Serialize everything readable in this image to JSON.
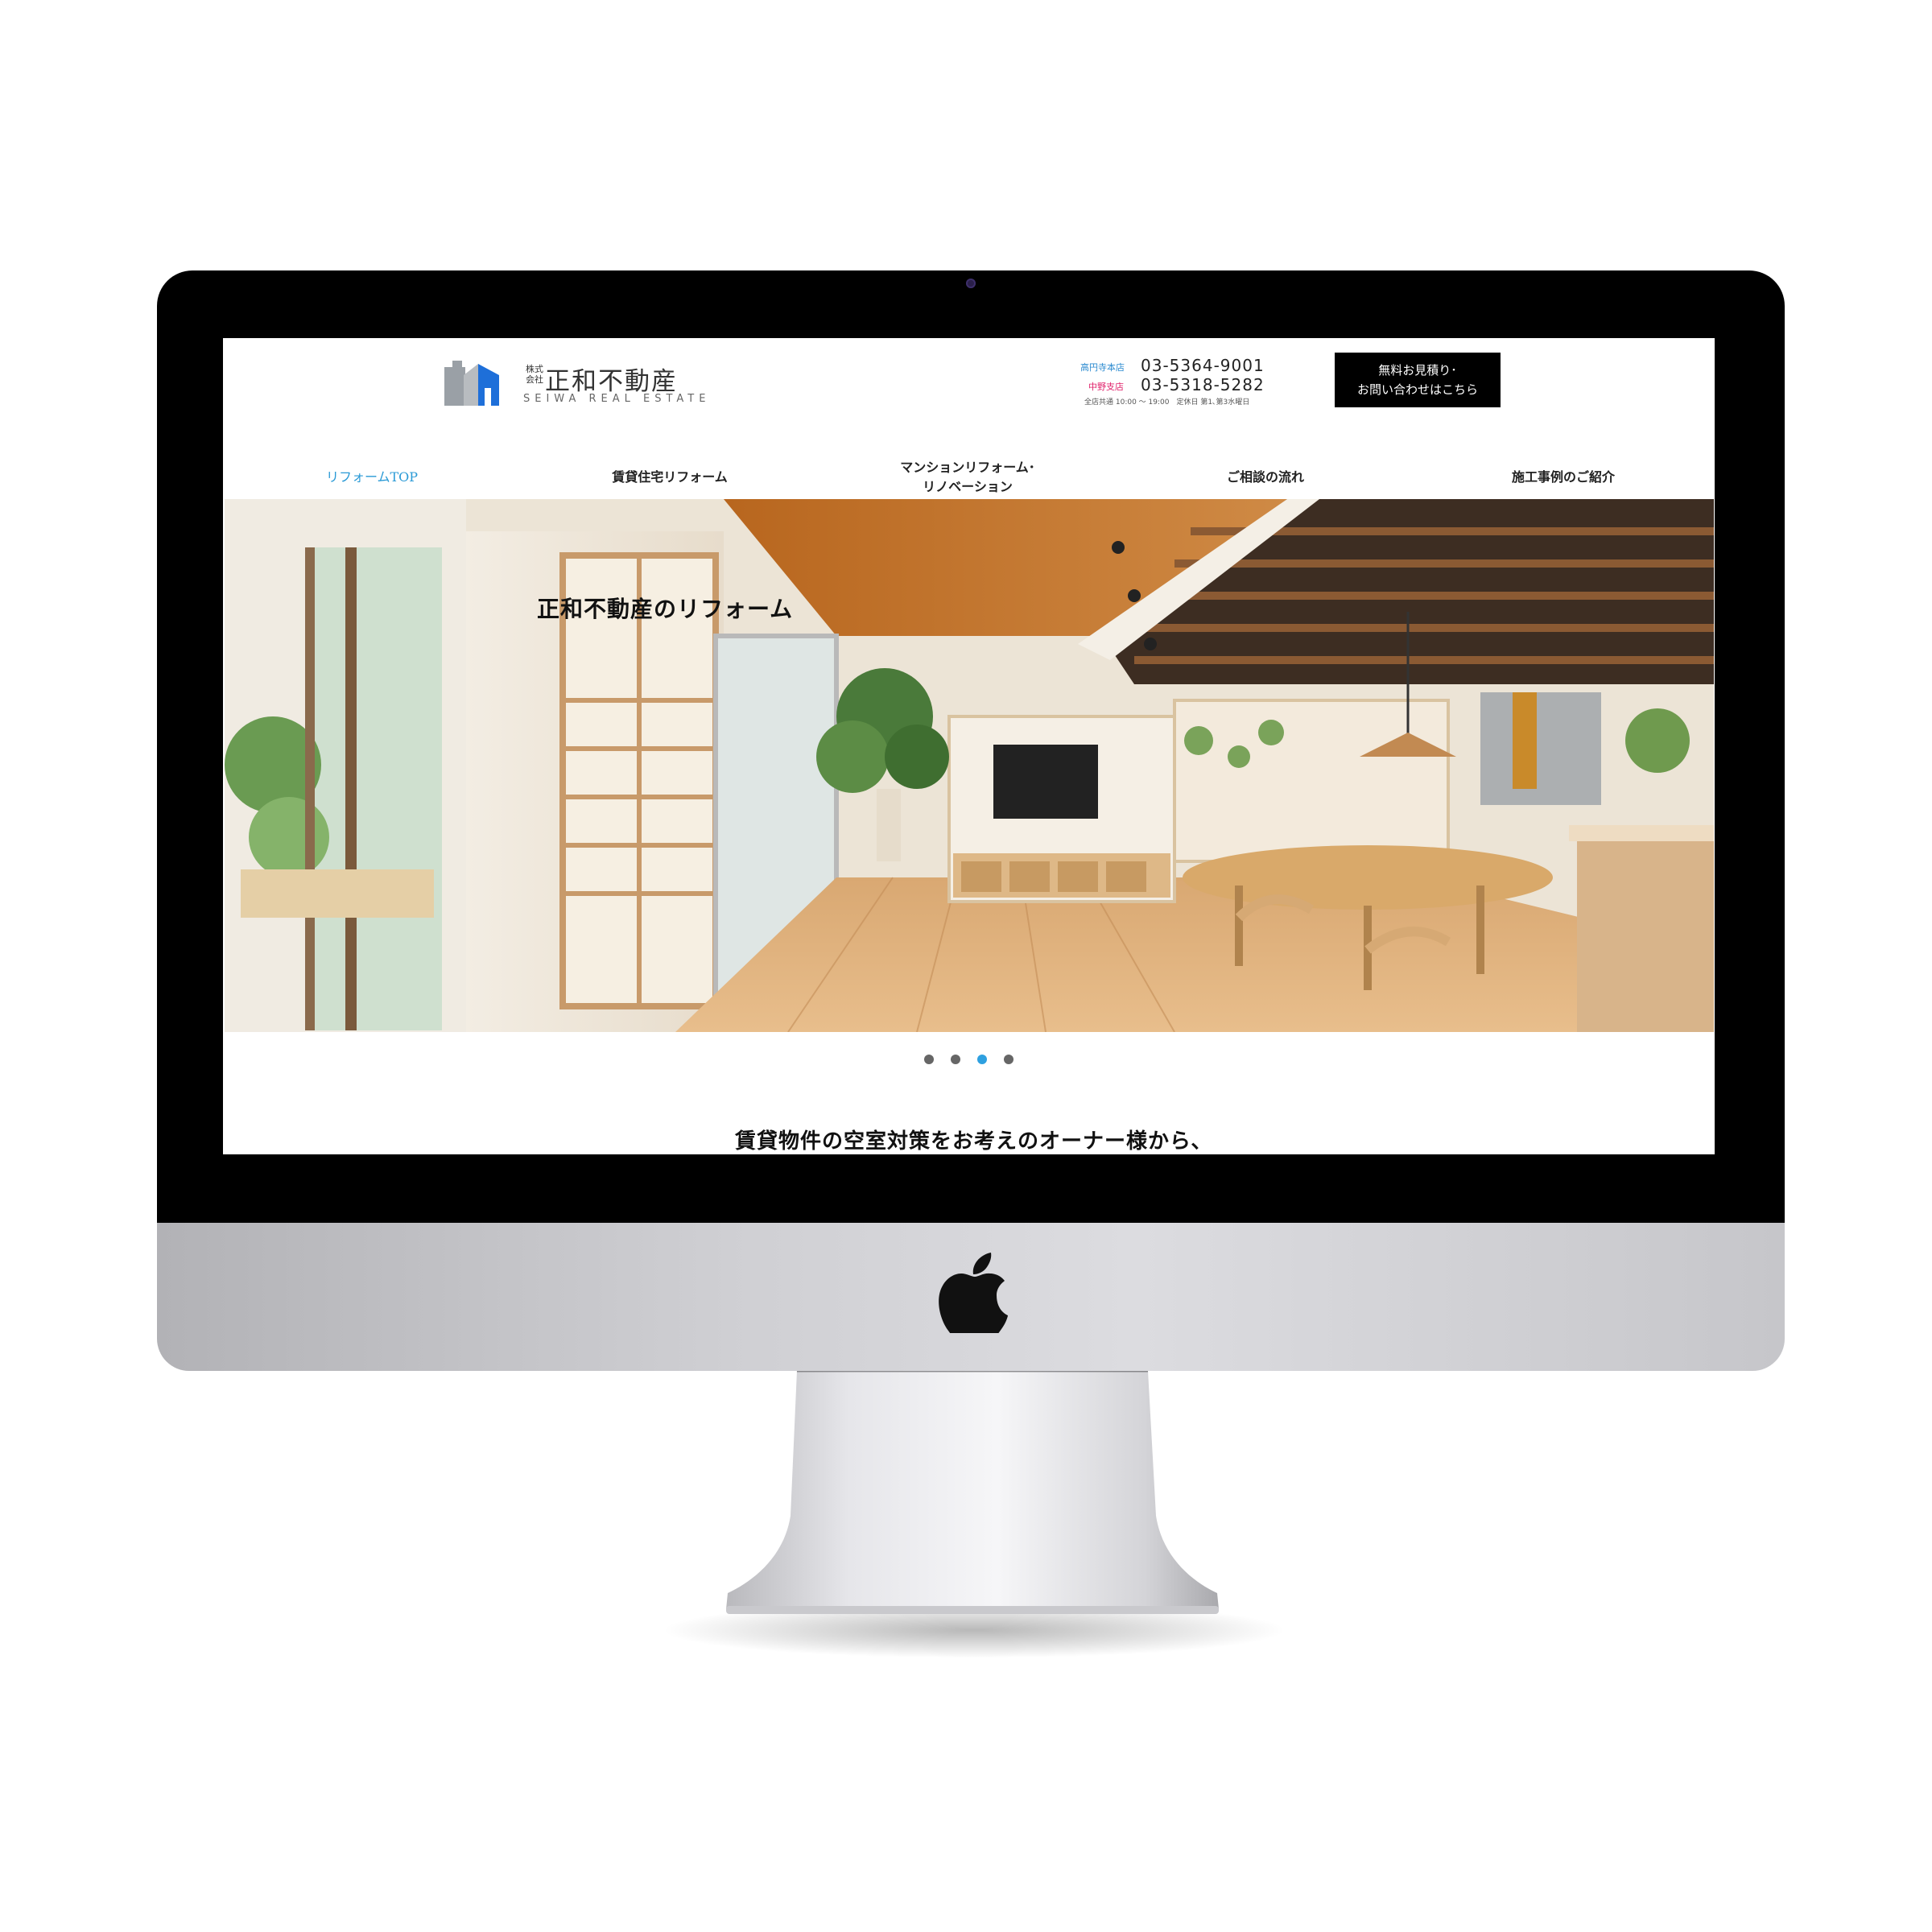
{
  "site": {
    "logo": {
      "kabu": "株式会社",
      "name": "正和不動産",
      "english": "SEIWA REAL ESTATE"
    },
    "contact": {
      "branches": [
        {
          "label": "高円寺本店",
          "phone": "03-5364-9001",
          "color": "#2a8ad0"
        },
        {
          "label": "中野支店",
          "phone": "03-5318-5282",
          "color": "#e0206a"
        }
      ],
      "hours": "全店共通 10:00 〜 19:00　定休日 第1､第3水曜日"
    },
    "cta": {
      "line1": "無料お見積り･",
      "line2": "お問い合わせはこちら"
    },
    "nav": [
      {
        "line1": "リフォームTOP",
        "line2": ""
      },
      {
        "line1": "賃貸住宅リフォーム",
        "line2": ""
      },
      {
        "line1": "マンションリフォーム･",
        "line2": "リノベーション"
      },
      {
        "line1": "ご相談の流れ",
        "line2": ""
      },
      {
        "line1": "施工事例のご紹介",
        "line2": ""
      }
    ],
    "active_nav_color": "#2a9ad6",
    "hero": {
      "title": "正和不動産のリフォーム"
    },
    "slider": {
      "total": 4,
      "active_index": 2,
      "active_color": "#2ea0e0"
    },
    "intro": "賃貸物件の空室対策をお考えのオーナー様から､"
  },
  "device": {
    "logo_icon": "apple-logo-icon"
  }
}
